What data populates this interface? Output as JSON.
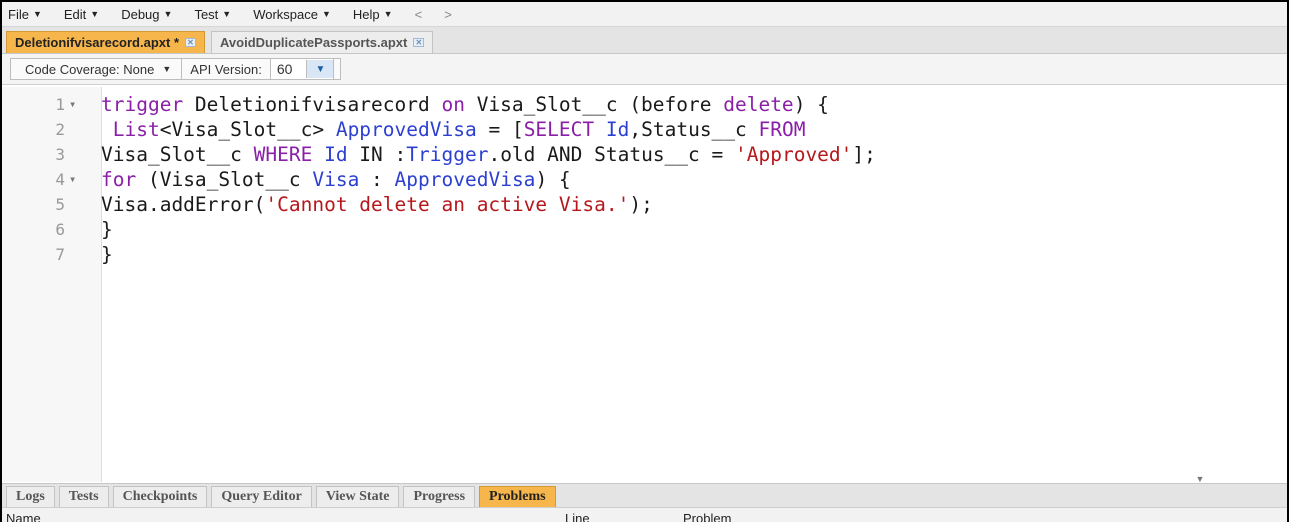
{
  "menu": {
    "items": [
      "File",
      "Edit",
      "Debug",
      "Test",
      "Workspace",
      "Help"
    ],
    "back": "<",
    "forward": ">"
  },
  "tabs": [
    {
      "label": "Deletionifvisarecord.apxt *",
      "active": true
    },
    {
      "label": "AvoidDuplicatePassports.apxt",
      "active": false
    }
  ],
  "toolbar": {
    "coverage_label": "Code Coverage: None",
    "api_label": "API Version:",
    "api_value": "60"
  },
  "code": [
    {
      "n": "1",
      "fold": true,
      "tokens": [
        [
          "kw",
          "trigger"
        ],
        [
          "p",
          " Deletionifvisarecord "
        ],
        [
          "kw",
          "on"
        ],
        [
          "p",
          " Visa_Slot__c (before "
        ],
        [
          "kw",
          "delete"
        ],
        [
          "p",
          ") {"
        ]
      ]
    },
    {
      "n": "2",
      "fold": false,
      "tokens": [
        [
          "p",
          " "
        ],
        [
          "kw",
          "List"
        ],
        [
          "p",
          "<Visa_Slot__c> "
        ],
        [
          "ty",
          "ApprovedVisa"
        ],
        [
          "p",
          " = ["
        ],
        [
          "kw",
          "SELECT"
        ],
        [
          "p",
          " "
        ],
        [
          "ty",
          "Id"
        ],
        [
          "p",
          ",Status__c "
        ],
        [
          "kw",
          "FROM"
        ]
      ]
    },
    {
      "n": "3",
      "fold": false,
      "tokens": [
        [
          "p",
          "Visa_Slot__c "
        ],
        [
          "kw",
          "WHERE"
        ],
        [
          "p",
          " "
        ],
        [
          "ty",
          "Id"
        ],
        [
          "p",
          " IN :"
        ],
        [
          "ty",
          "Trigger"
        ],
        [
          "p",
          ".old AND Status__c = "
        ],
        [
          "str",
          "'Approved'"
        ],
        [
          "p",
          "];"
        ]
      ]
    },
    {
      "n": "4",
      "fold": true,
      "tokens": [
        [
          "kw",
          "for"
        ],
        [
          "p",
          " (Visa_Slot__c "
        ],
        [
          "ty",
          "Visa"
        ],
        [
          "p",
          " : "
        ],
        [
          "ty",
          "ApprovedVisa"
        ],
        [
          "p",
          ") {"
        ]
      ]
    },
    {
      "n": "5",
      "fold": false,
      "tokens": [
        [
          "p",
          "Visa.addError("
        ],
        [
          "str",
          "'Cannot delete an active Visa.'"
        ],
        [
          "p",
          ");"
        ]
      ]
    },
    {
      "n": "6",
      "fold": false,
      "tokens": [
        [
          "p",
          "}"
        ]
      ]
    },
    {
      "n": "7",
      "fold": false,
      "tokens": [
        [
          "p",
          "}"
        ]
      ]
    }
  ],
  "bottom_tabs": [
    {
      "label": "Logs",
      "active": false
    },
    {
      "label": "Tests",
      "active": false
    },
    {
      "label": "Checkpoints",
      "active": false
    },
    {
      "label": "Query Editor",
      "active": false
    },
    {
      "label": "View State",
      "active": false
    },
    {
      "label": "Progress",
      "active": false
    },
    {
      "label": "Problems",
      "active": true
    }
  ],
  "problems_table": {
    "columns": [
      "Name",
      "Line",
      "Problem"
    ]
  },
  "colors": {
    "active_tab": "#f7b64b",
    "keyword": "#8a1fa8",
    "type": "#2c3fd0",
    "string": "#b5181c"
  },
  "icons": [
    "tab-close-icon",
    "chevron-down-icon",
    "fold-arrow-icon"
  ]
}
